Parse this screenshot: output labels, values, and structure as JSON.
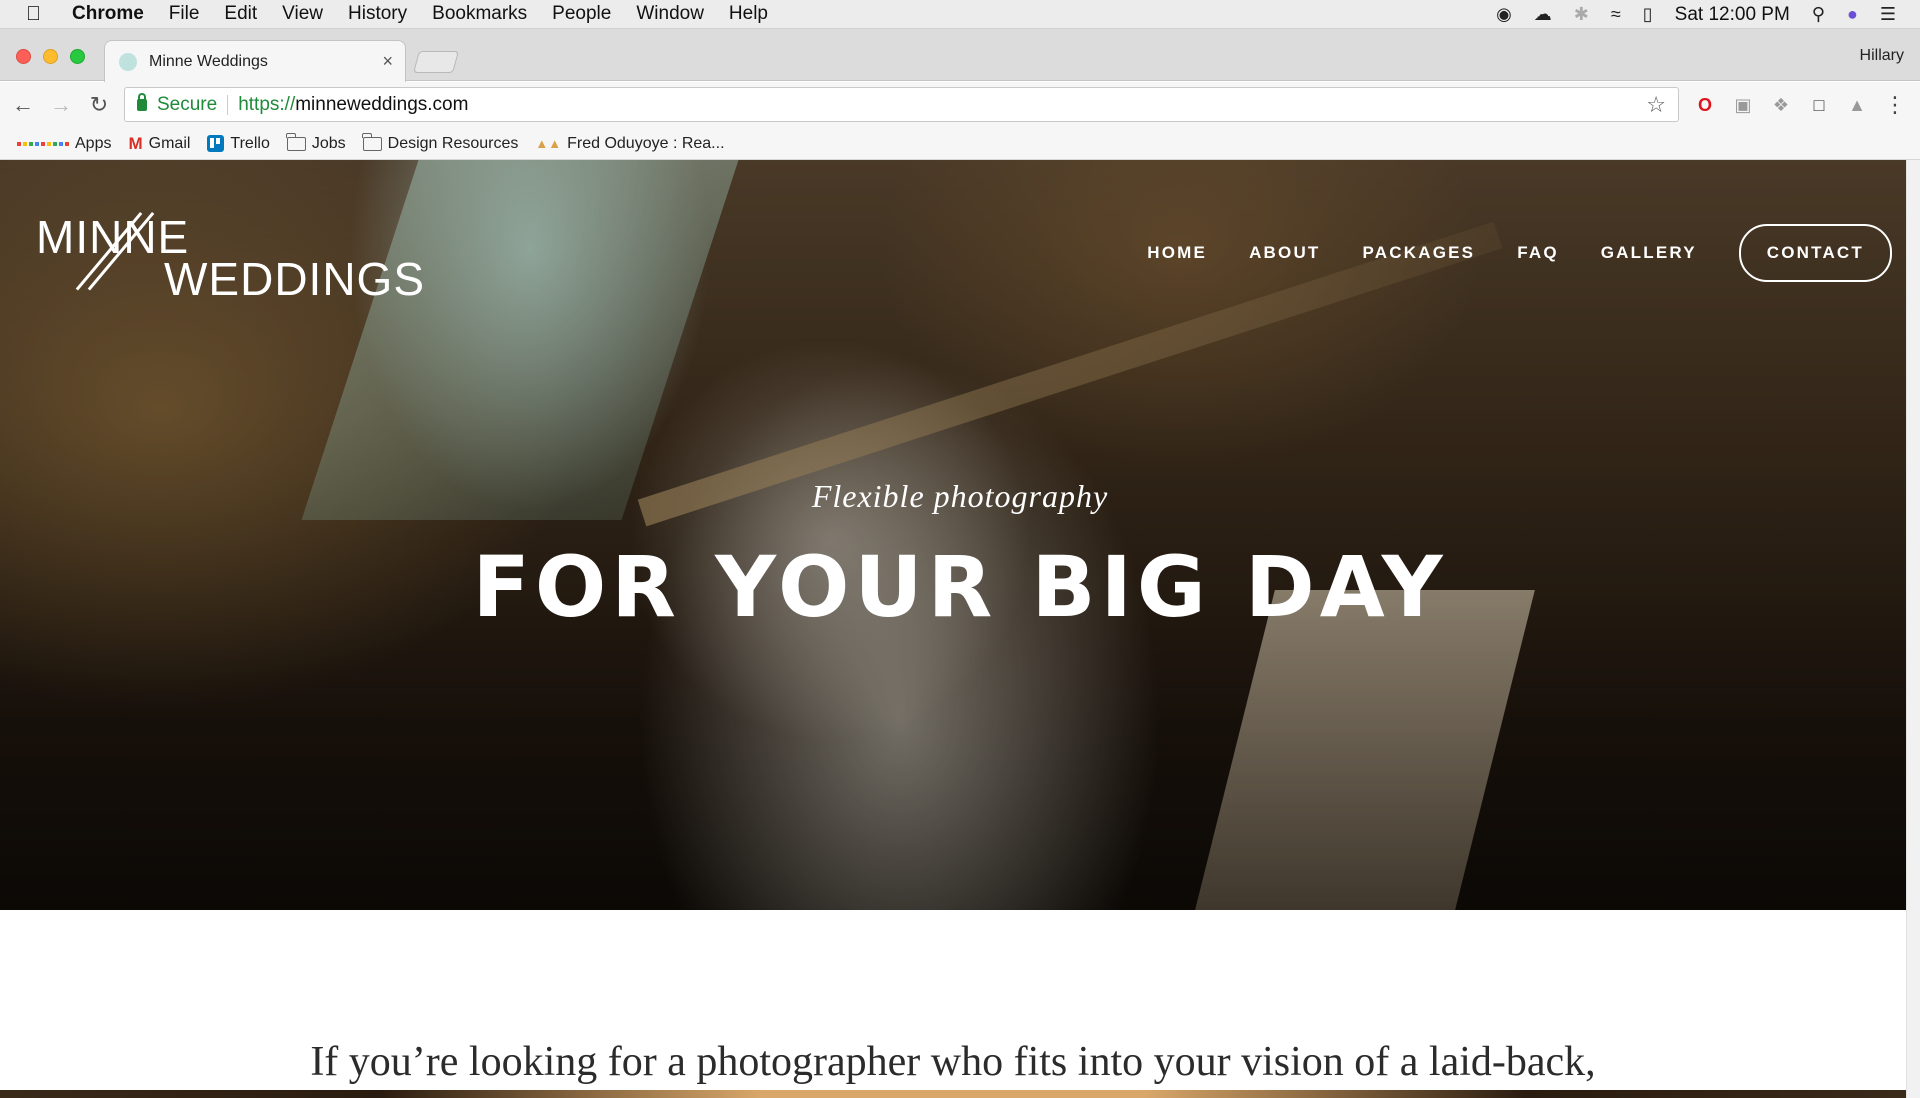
{
  "menubar": {
    "app": "Chrome",
    "items": [
      "File",
      "Edit",
      "View",
      "History",
      "Bookmarks",
      "People",
      "Window",
      "Help"
    ],
    "clock": "Sat 12:00 PM",
    "status_icons": [
      "creative-cloud-icon",
      "cloud-upload-icon",
      "bluetooth-icon",
      "wifi-icon",
      "battery-charging-icon",
      "spotlight-search-icon",
      "siri-icon",
      "notification-center-icon"
    ]
  },
  "tab": {
    "title": "Minne Weddings",
    "close": "×"
  },
  "profile": "Hillary",
  "omnibox": {
    "secure": "Secure",
    "scheme": "https://",
    "host": "minneweddings.com"
  },
  "bookmarks": [
    {
      "label": "Apps",
      "icon": "apps-grid-icon"
    },
    {
      "label": "Gmail",
      "icon": "gmail-icon"
    },
    {
      "label": "Trello",
      "icon": "trello-icon"
    },
    {
      "label": "Jobs",
      "icon": "folder-icon"
    },
    {
      "label": "Design Resources",
      "icon": "folder-icon"
    },
    {
      "label": "Fred Oduyoye : Rea...",
      "icon": "fred-favicon-icon"
    }
  ],
  "site": {
    "logo": {
      "line1": "MINNE",
      "line2": "WEDDINGS"
    },
    "nav": [
      "HOME",
      "ABOUT",
      "PACKAGES",
      "FAQ",
      "GALLERY"
    ],
    "contact": "CONTACT",
    "hero_subtitle": "Flexible photography",
    "hero_title": "FOR YOUR BIG DAY",
    "intro": "If you’re looking for a photographer who fits into your vision of a laid-back,"
  },
  "colors": {
    "secure_green": "#1f8b3a",
    "opera_red": "#e0141e",
    "trello_blue": "#0079bf"
  }
}
